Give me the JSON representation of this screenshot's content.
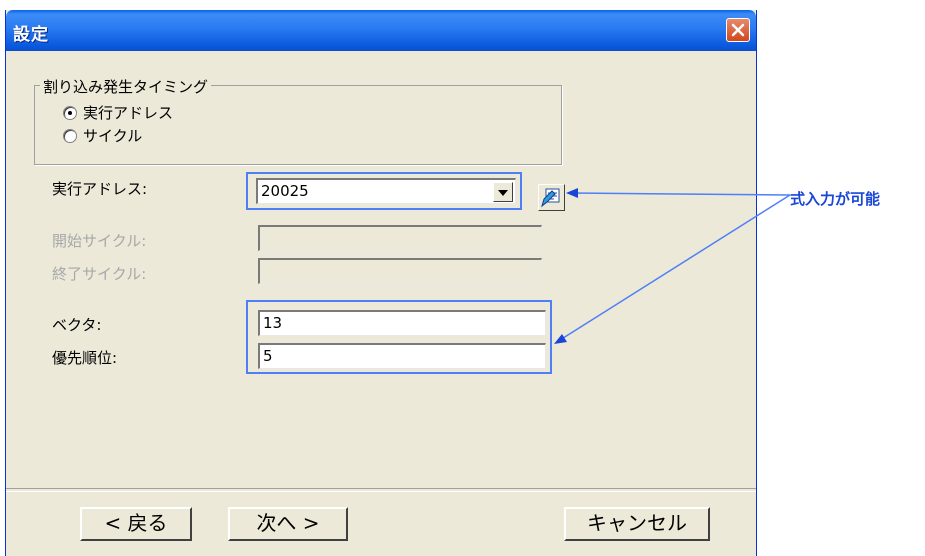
{
  "dialog": {
    "title": "設定",
    "close_icon": "close-x-icon"
  },
  "timing_group": {
    "legend": "割り込み発生タイミング",
    "options": [
      {
        "label": "実行アドレス",
        "checked": true
      },
      {
        "label": "サイクル",
        "checked": false
      }
    ]
  },
  "fields": {
    "exec_address": {
      "label": "実行アドレス:",
      "value": "20025"
    },
    "start_cycle": {
      "label": "開始サイクル:",
      "value": ""
    },
    "end_cycle": {
      "label": "終了サイクル:",
      "value": ""
    },
    "vector": {
      "label": "ベクタ:",
      "value": "13"
    },
    "priority": {
      "label": "優先順位:",
      "value": "5"
    }
  },
  "buttons": {
    "back": "< 戻る",
    "next": "次へ >",
    "cancel": "キャンセル"
  },
  "annotation": {
    "text": "式入力が可能",
    "color": "#1a46d8"
  }
}
